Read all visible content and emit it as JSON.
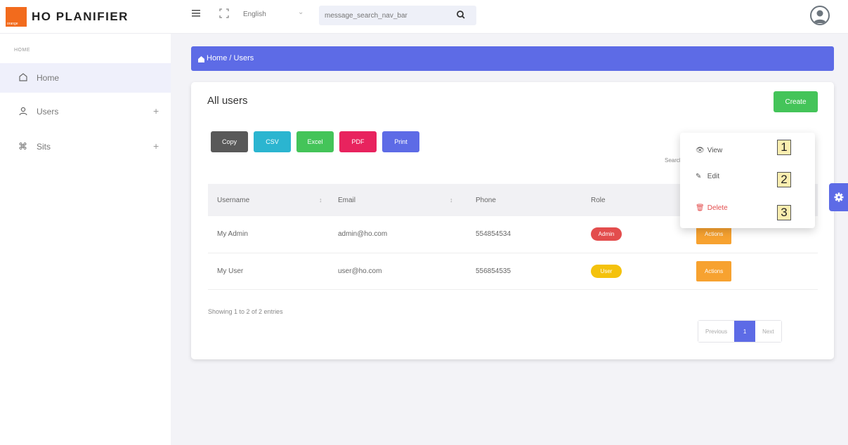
{
  "app": {
    "brand": "HO PLANIFIER",
    "logo_text": "orange",
    "brand_color": "#f26b1d",
    "accent_color": "#5d6be6"
  },
  "topbar": {
    "menu_icon": "hamburger-icon",
    "fullscreen_icon": "fullscreen-icon",
    "language": "English",
    "search_placeholder": "message_search_nav_bar",
    "search_icon": "search-icon",
    "avatar_icon": "user-avatar-icon"
  },
  "sidebar": {
    "heading": "HOME",
    "items": [
      {
        "label": "Home",
        "icon": "home-icon",
        "expandable": false,
        "active": true
      },
      {
        "label": "Users",
        "icon": "user-icon",
        "expandable": true,
        "active": false
      },
      {
        "label": "Sits",
        "icon": "command-icon",
        "expandable": true,
        "active": false
      }
    ],
    "plus": "+"
  },
  "breadcrumb": {
    "text": "Home / Users"
  },
  "card": {
    "title": "All users",
    "create_label": "Create",
    "export_buttons": [
      {
        "label": "Copy",
        "color": "#595959"
      },
      {
        "label": "CSV",
        "color": "#2bb5d0"
      },
      {
        "label": "Excel",
        "color": "#44c459"
      },
      {
        "label": "PDF",
        "color": "#e8235e"
      },
      {
        "label": "Print",
        "color": "#5d6be6"
      }
    ],
    "search_label": "Search:",
    "table": {
      "headers": [
        "Username",
        "Email",
        "Phone",
        "Role",
        ""
      ],
      "rows": [
        {
          "username": "My Admin",
          "email": "admin@ho.com",
          "phone": "554854534",
          "role": "Admin",
          "role_color": "#e34d4d",
          "action": "Actions"
        },
        {
          "username": "My User",
          "email": "user@ho.com",
          "phone": "556854535",
          "role": "User",
          "role_color": "#f4c20d",
          "action": "Actions"
        }
      ]
    },
    "showing": "Showing 1 to 2 of 2 entries",
    "pagination": {
      "previous": "Previous",
      "current": "1",
      "next": "Next"
    }
  },
  "dropdown": {
    "items": [
      {
        "label": "View",
        "icon": "eye-icon"
      },
      {
        "label": "Edit",
        "icon": "edit-icon"
      },
      {
        "label": "Delete",
        "icon": "trash-icon"
      }
    ],
    "tags": [
      "1",
      "2",
      "3"
    ]
  },
  "settings_icon": "gear-icon"
}
